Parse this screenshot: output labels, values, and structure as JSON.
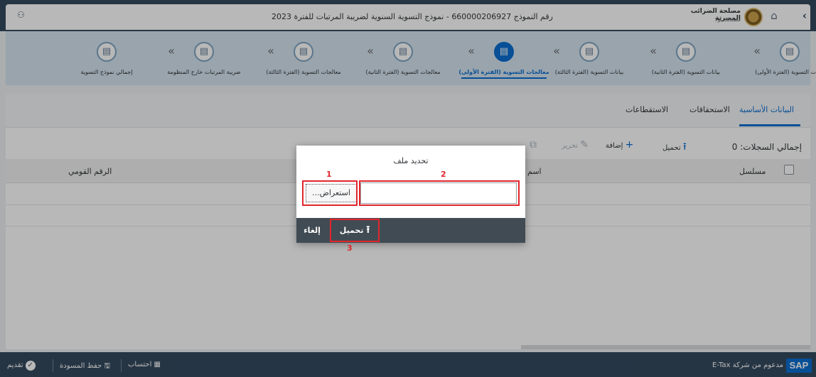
{
  "shell": {
    "title": "رقم النموذج 660000206927 - نموذج التسوية السنوية لضريبة المرتبات للفترة 2023",
    "org_name": "مصلحة الضرائب المصرية",
    "org_sub": "مصلحتك أولا"
  },
  "wizard": {
    "steps": [
      {
        "label": "بيانات التسوية (الفترة الأولى)"
      },
      {
        "label": "بيانات التسوية (الفترة الثانية)"
      },
      {
        "label": "بيانات التسوية (الفترة الثالثة)"
      },
      {
        "label": "معالجات التسوية (الفترة الأولى)"
      },
      {
        "label": "معالجات التسوية (الفترة الثانية)"
      },
      {
        "label": "معالجات التسوية (الفترة الثالثة)"
      },
      {
        "label": "ضريبة المرتبات خارج المنظومة"
      },
      {
        "label": "إجمالي نموذج التسوية"
      }
    ],
    "separator": "«",
    "active_index": 3
  },
  "tabs": [
    {
      "label": "البيانات الأساسية"
    },
    {
      "label": "الاستحقاقات"
    },
    {
      "label": "الاستقطاعات"
    }
  ],
  "toolbar": {
    "total_label": "إجمالي السجلات: 0",
    "upload_label": "تحميل",
    "add_label": "إضافة",
    "edit_label": "تحرير",
    "delete_label": "حذف"
  },
  "table": {
    "columns": [
      "مسلسل",
      "اسم",
      "الرقم القومي"
    ]
  },
  "dialog": {
    "title": "تحديد ملف",
    "browse_label": "استعراض...",
    "upload_label": "تحميل",
    "cancel_label": "إلغاء",
    "callout_1": "1",
    "callout_2": "2",
    "callout_3": "3"
  },
  "footer": {
    "powered_by": "مدعوم من شركة E-Tax",
    "sap_label": "SAP",
    "submit_label": "تقديم",
    "save_draft_label": "حفظ المسودة",
    "calculate_label": "احتساب"
  },
  "colors": {
    "shell": "#354a5f",
    "accent": "#0a6ed1",
    "callout": "#e0262d",
    "wizard_bg": "#d5e3ef"
  },
  "icons": {
    "back": "chevron-left-icon",
    "home": "home-icon",
    "person": "person-settings-icon",
    "step": "document-icon",
    "upload": "upload-icon",
    "submit": "check-circle-icon",
    "save": "save-icon",
    "calculate": "calculator-icon"
  }
}
